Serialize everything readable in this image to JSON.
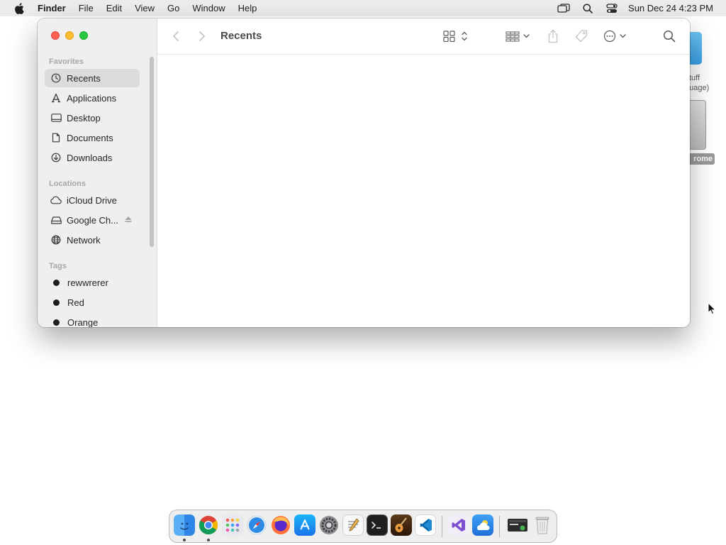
{
  "menubar": {
    "app_name": "Finder",
    "menus": [
      "File",
      "Edit",
      "View",
      "Go",
      "Window",
      "Help"
    ],
    "clock": "Sun Dec 24  4:23 PM"
  },
  "desktop": {
    "folder_label_line1": "tuff",
    "folder_label_line2": "guage)",
    "disk_label": "rome"
  },
  "window": {
    "title": "Recents",
    "sidebar": {
      "favorites_heading": "Favorites",
      "favorites": [
        {
          "label": "Recents",
          "icon": "clock-icon",
          "selected": true
        },
        {
          "label": "Applications",
          "icon": "applications-icon"
        },
        {
          "label": "Desktop",
          "icon": "desktop-icon"
        },
        {
          "label": "Documents",
          "icon": "document-icon"
        },
        {
          "label": "Downloads",
          "icon": "download-icon"
        }
      ],
      "locations_heading": "Locations",
      "locations": [
        {
          "label": "iCloud Drive",
          "icon": "cloud-icon"
        },
        {
          "label": "Google Ch...",
          "icon": "drive-icon",
          "ejectable": true
        },
        {
          "label": "Network",
          "icon": "globe-icon"
        }
      ],
      "tags_heading": "Tags",
      "tags": [
        {
          "label": "rewwrerer",
          "color": "#1d1d1f"
        },
        {
          "label": "Red",
          "color": "#1d1d1f"
        },
        {
          "label": "Orange",
          "color": "#1d1d1f"
        }
      ]
    }
  },
  "colors": {
    "close": "#fe5f57",
    "minimize": "#febc2e",
    "maximize": "#28c840"
  }
}
